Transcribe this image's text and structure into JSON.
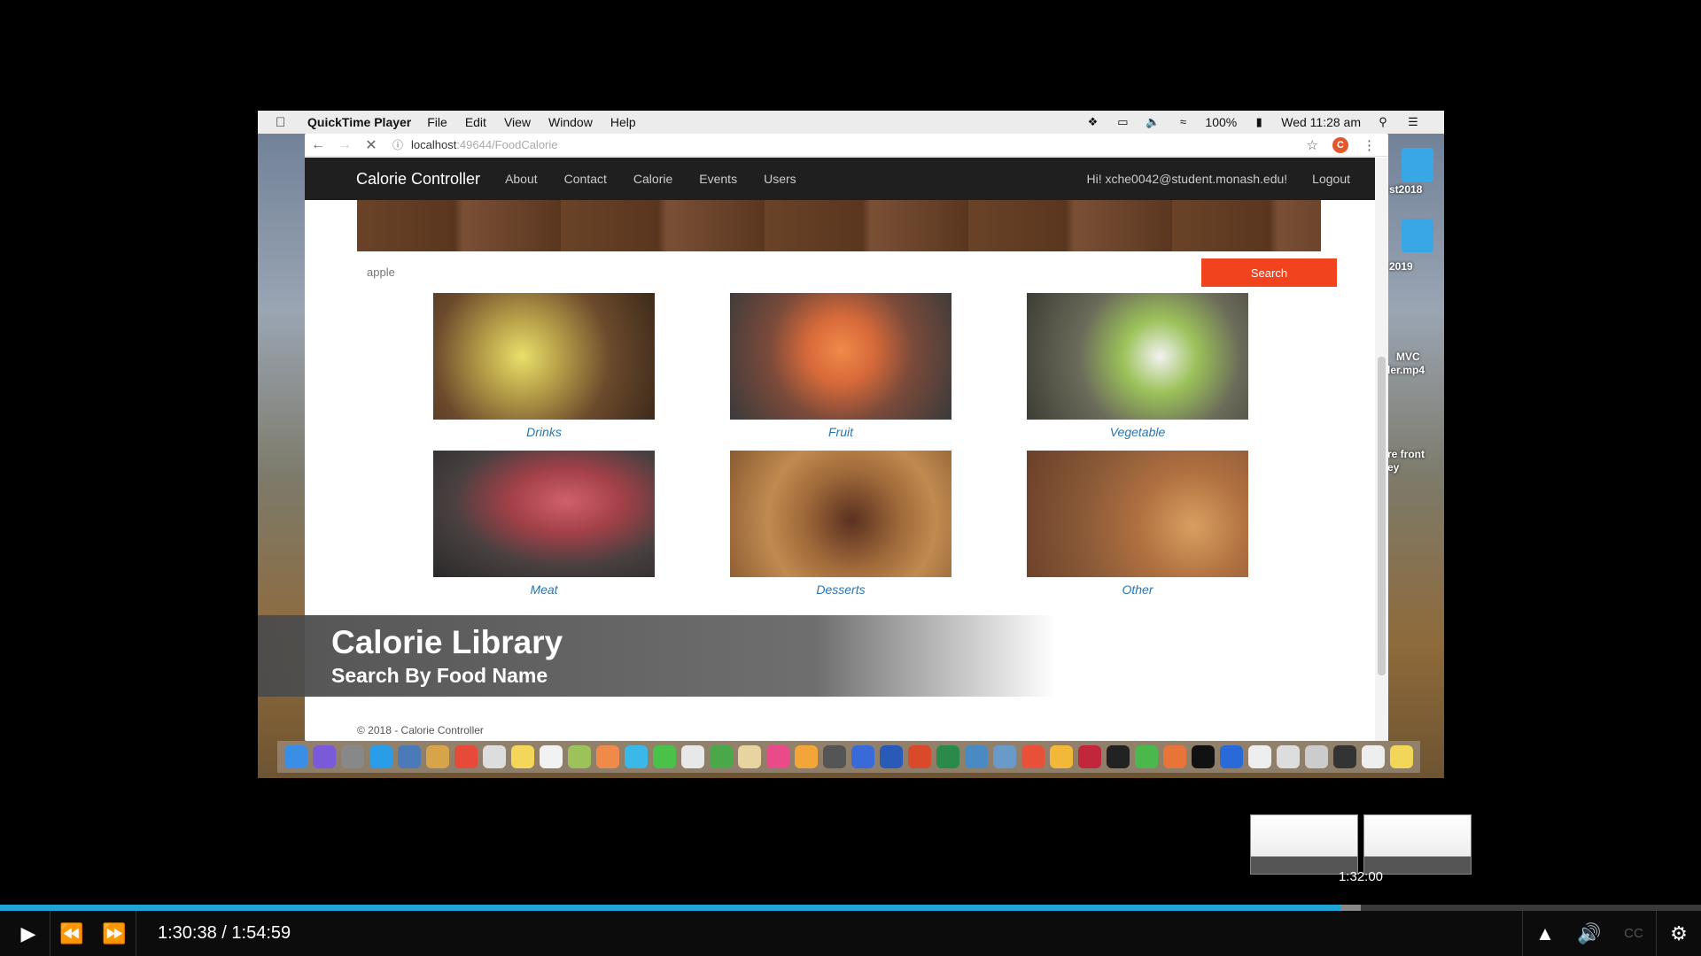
{
  "menubar": {
    "app_name": "QuickTime Player",
    "menus": [
      "File",
      "Edit",
      "View",
      "Window",
      "Help"
    ],
    "battery": "100%",
    "clock": "Wed 11:28 am"
  },
  "desktop": {
    "labels": [
      "st2018",
      "2019",
      "MVC",
      "ler.mp4",
      "re front",
      "ey"
    ]
  },
  "browser": {
    "url_host": "localhost",
    "url_path": ":49644/FoodCalorie",
    "profile_initial": "C"
  },
  "site": {
    "brand": "Calorie Controller",
    "nav": [
      "About",
      "Contact",
      "Calorie",
      "Events",
      "Users"
    ],
    "greeting": "Hi! xche0042@student.monash.edu!",
    "logout": "Logout",
    "search_value": "apple",
    "search_button": "Search",
    "categories": [
      "Drinks",
      "Fruit",
      "Vegetable",
      "Meat",
      "Desserts",
      "Other"
    ],
    "footer": "© 2018 - Calorie Controller"
  },
  "lower_third": {
    "title": "Calorie Library",
    "subtitle": "Search By Food Name"
  },
  "player": {
    "time": "1:30:38 / 1:54:59",
    "preview_time": "1:32:00",
    "progress": 0.788,
    "buffered": 0.8,
    "cc_label": "CC",
    "colors": {
      "progress": "#1fa4d8",
      "search_button": "#f2431f"
    }
  }
}
